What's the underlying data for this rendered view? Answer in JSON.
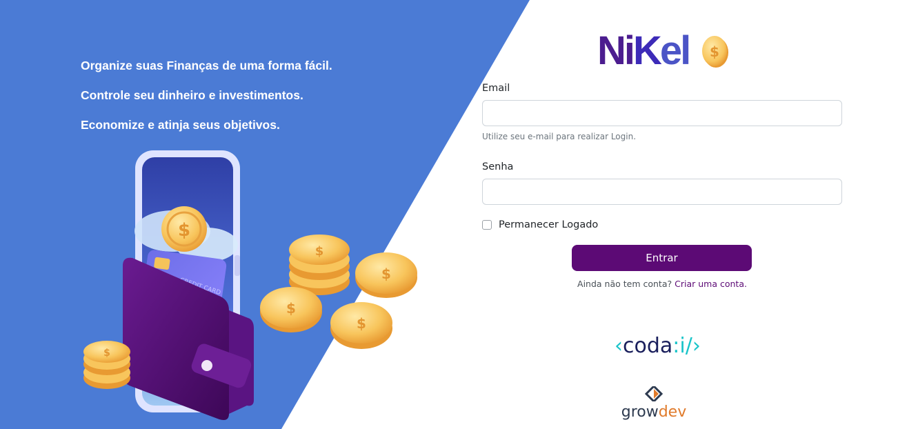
{
  "hero": {
    "lines": [
      "Organize suas Finanças de uma forma fácil.",
      "Controle seu dinheiro e investimentos.",
      "Economize e atinja seus objetivos."
    ],
    "card_label": "CREDIT CARD"
  },
  "brand": {
    "name": "NiKel",
    "part1": "Ni",
    "part2": "K",
    "part3": "el"
  },
  "form": {
    "email_label": "Email",
    "email_value": "",
    "email_help": "Utilize seu e-mail para realizar Login.",
    "password_label": "Senha",
    "password_value": "",
    "remember_label": "Permanecer Logado",
    "remember_checked": false,
    "submit_label": "Entrar",
    "signup_prefix": "Ainda não tem conta?",
    "signup_link": "Criar uma conta."
  },
  "partners": {
    "coda_open": "‹",
    "coda_text": "coda",
    "coda_suffix": ":i/",
    "coda_close": "›",
    "growdev_part1": "grow",
    "growdev_part2": "dev"
  },
  "colors": {
    "hero_blue": "#4b7bd5",
    "primary_purple": "#5c0a75",
    "coin_gold": "#f7c052",
    "wallet_purple": "#4e0c6e"
  },
  "icons": [
    "coin-icon",
    "wallet-icon",
    "phone-icon",
    "growdev-icon",
    "checkbox-icon"
  ]
}
